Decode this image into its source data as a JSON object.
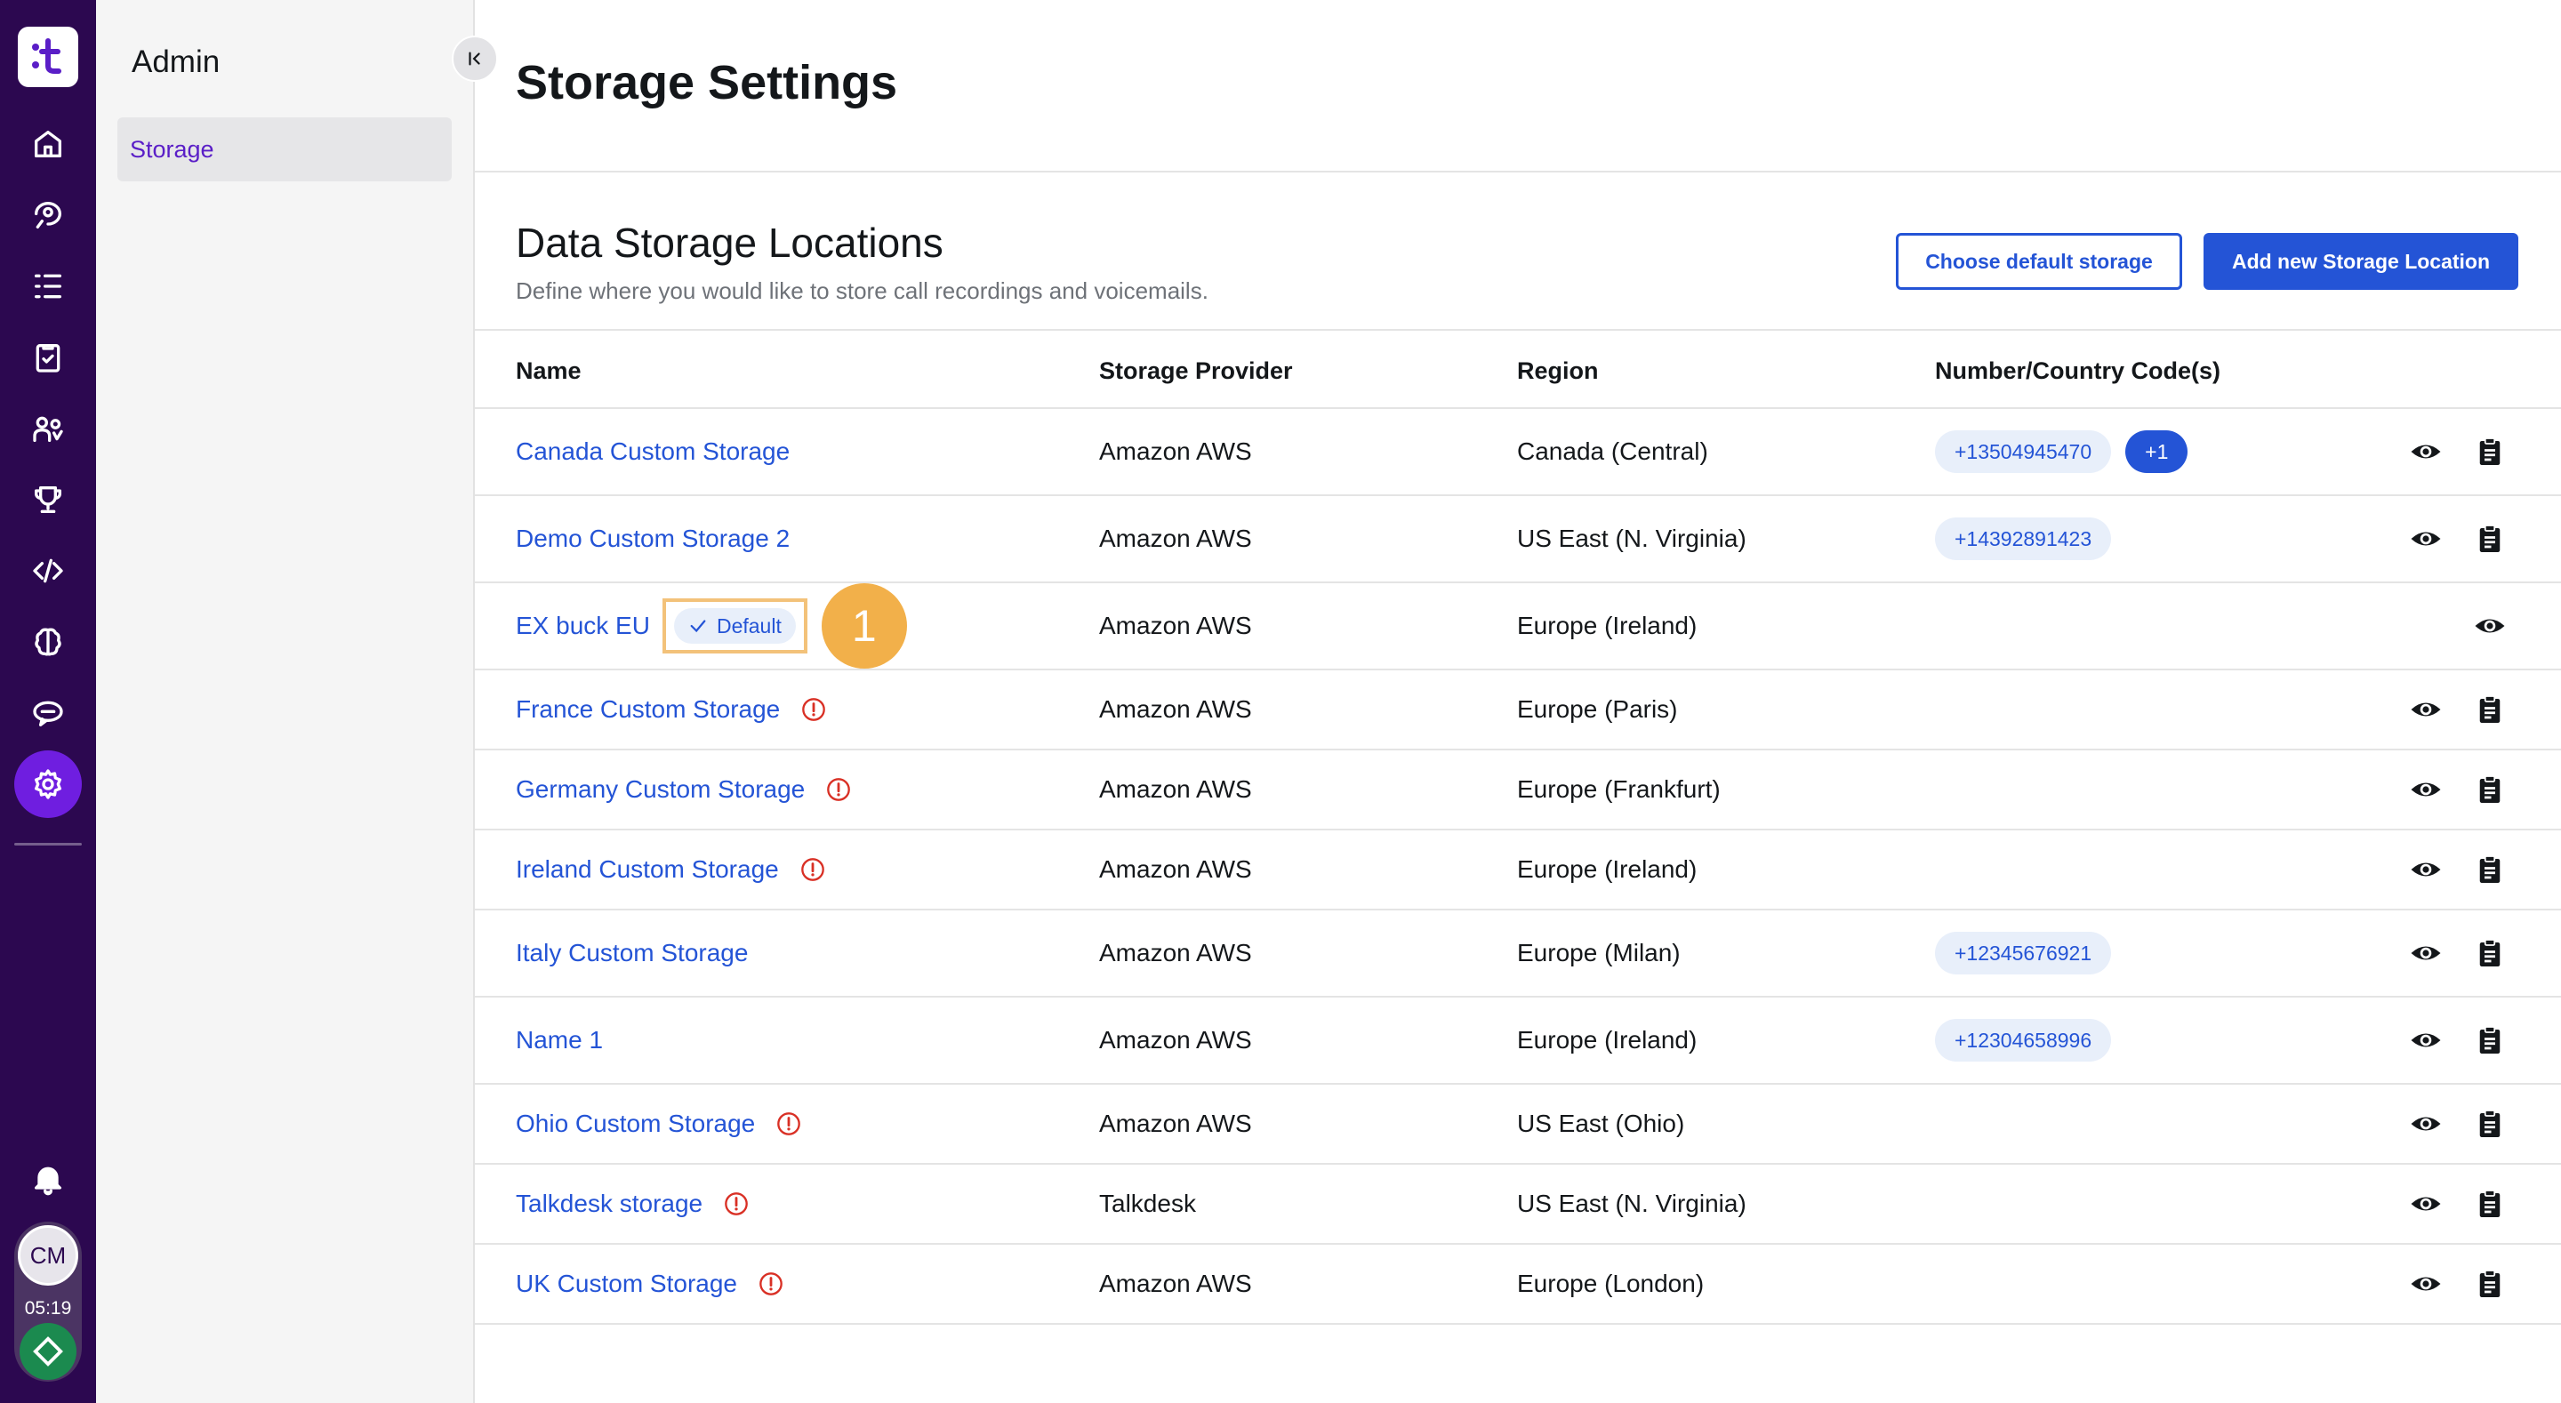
{
  "rail": {
    "items": [
      "home-icon",
      "contacts-icon",
      "list-icon",
      "clipboard-check-icon",
      "users-icon",
      "trophy-icon",
      "code-icon",
      "brain-icon",
      "chat-icon",
      "settings-icon"
    ],
    "active": "settings-icon",
    "user_initials": "CM",
    "timer": "05:19",
    "accent": "#6f1ee0",
    "background": "#2c0850"
  },
  "subnav": {
    "title": "Admin",
    "items": [
      {
        "label": "Storage",
        "active": true
      }
    ]
  },
  "page": {
    "title": "Storage Settings",
    "section_title": "Data Storage Locations",
    "section_desc": "Define where you would like to store call recordings and voicemails.",
    "choose_default_label": "Choose default storage",
    "add_new_label": "Add new Storage Location"
  },
  "table": {
    "headers": {
      "name": "Name",
      "provider": "Storage Provider",
      "region": "Region",
      "codes": "Number/Country Code(s)"
    },
    "rows": [
      {
        "name": "Canada Custom Storage",
        "provider": "Amazon AWS",
        "region": "Canada (Central)",
        "codes": [
          "+13504945470"
        ],
        "more": "+1",
        "warning": false
      },
      {
        "name": "Demo Custom Storage 2",
        "provider": "Amazon AWS",
        "region": "US East (N. Virginia)",
        "codes": [
          "+14392891423"
        ],
        "warning": false
      },
      {
        "name": "EX buck EU",
        "provider": "Amazon AWS",
        "region": "Europe (Ireland)",
        "codes": [],
        "warning": false,
        "default_label": "Default",
        "step": "1"
      },
      {
        "name": "France Custom Storage",
        "provider": "Amazon AWS",
        "region": "Europe (Paris)",
        "codes": [],
        "warning": true
      },
      {
        "name": "Germany Custom Storage",
        "provider": "Amazon AWS",
        "region": "Europe (Frankfurt)",
        "codes": [],
        "warning": true
      },
      {
        "name": "Ireland Custom Storage",
        "provider": "Amazon AWS",
        "region": "Europe (Ireland)",
        "codes": [],
        "warning": true
      },
      {
        "name": "Italy Custom Storage",
        "provider": "Amazon AWS",
        "region": "Europe (Milan)",
        "codes": [
          "+12345676921"
        ],
        "warning": false
      },
      {
        "name": "Name 1",
        "provider": "Amazon AWS",
        "region": "Europe (Ireland)",
        "codes": [
          "+12304658996"
        ],
        "warning": false
      },
      {
        "name": "Ohio Custom Storage",
        "provider": "Amazon AWS",
        "region": "US East (Ohio)",
        "codes": [],
        "warning": true
      },
      {
        "name": "Talkdesk storage",
        "provider": "Talkdesk",
        "region": "US East (N. Virginia)",
        "codes": [],
        "warning": true
      },
      {
        "name": "UK Custom Storage",
        "provider": "Amazon AWS",
        "region": "Europe (London)",
        "codes": [],
        "warning": true
      }
    ]
  },
  "colors": {
    "link": "#2454d6",
    "warning": "#d93025",
    "highlight": "#f3c27a",
    "step_badge": "#f2b04a"
  }
}
